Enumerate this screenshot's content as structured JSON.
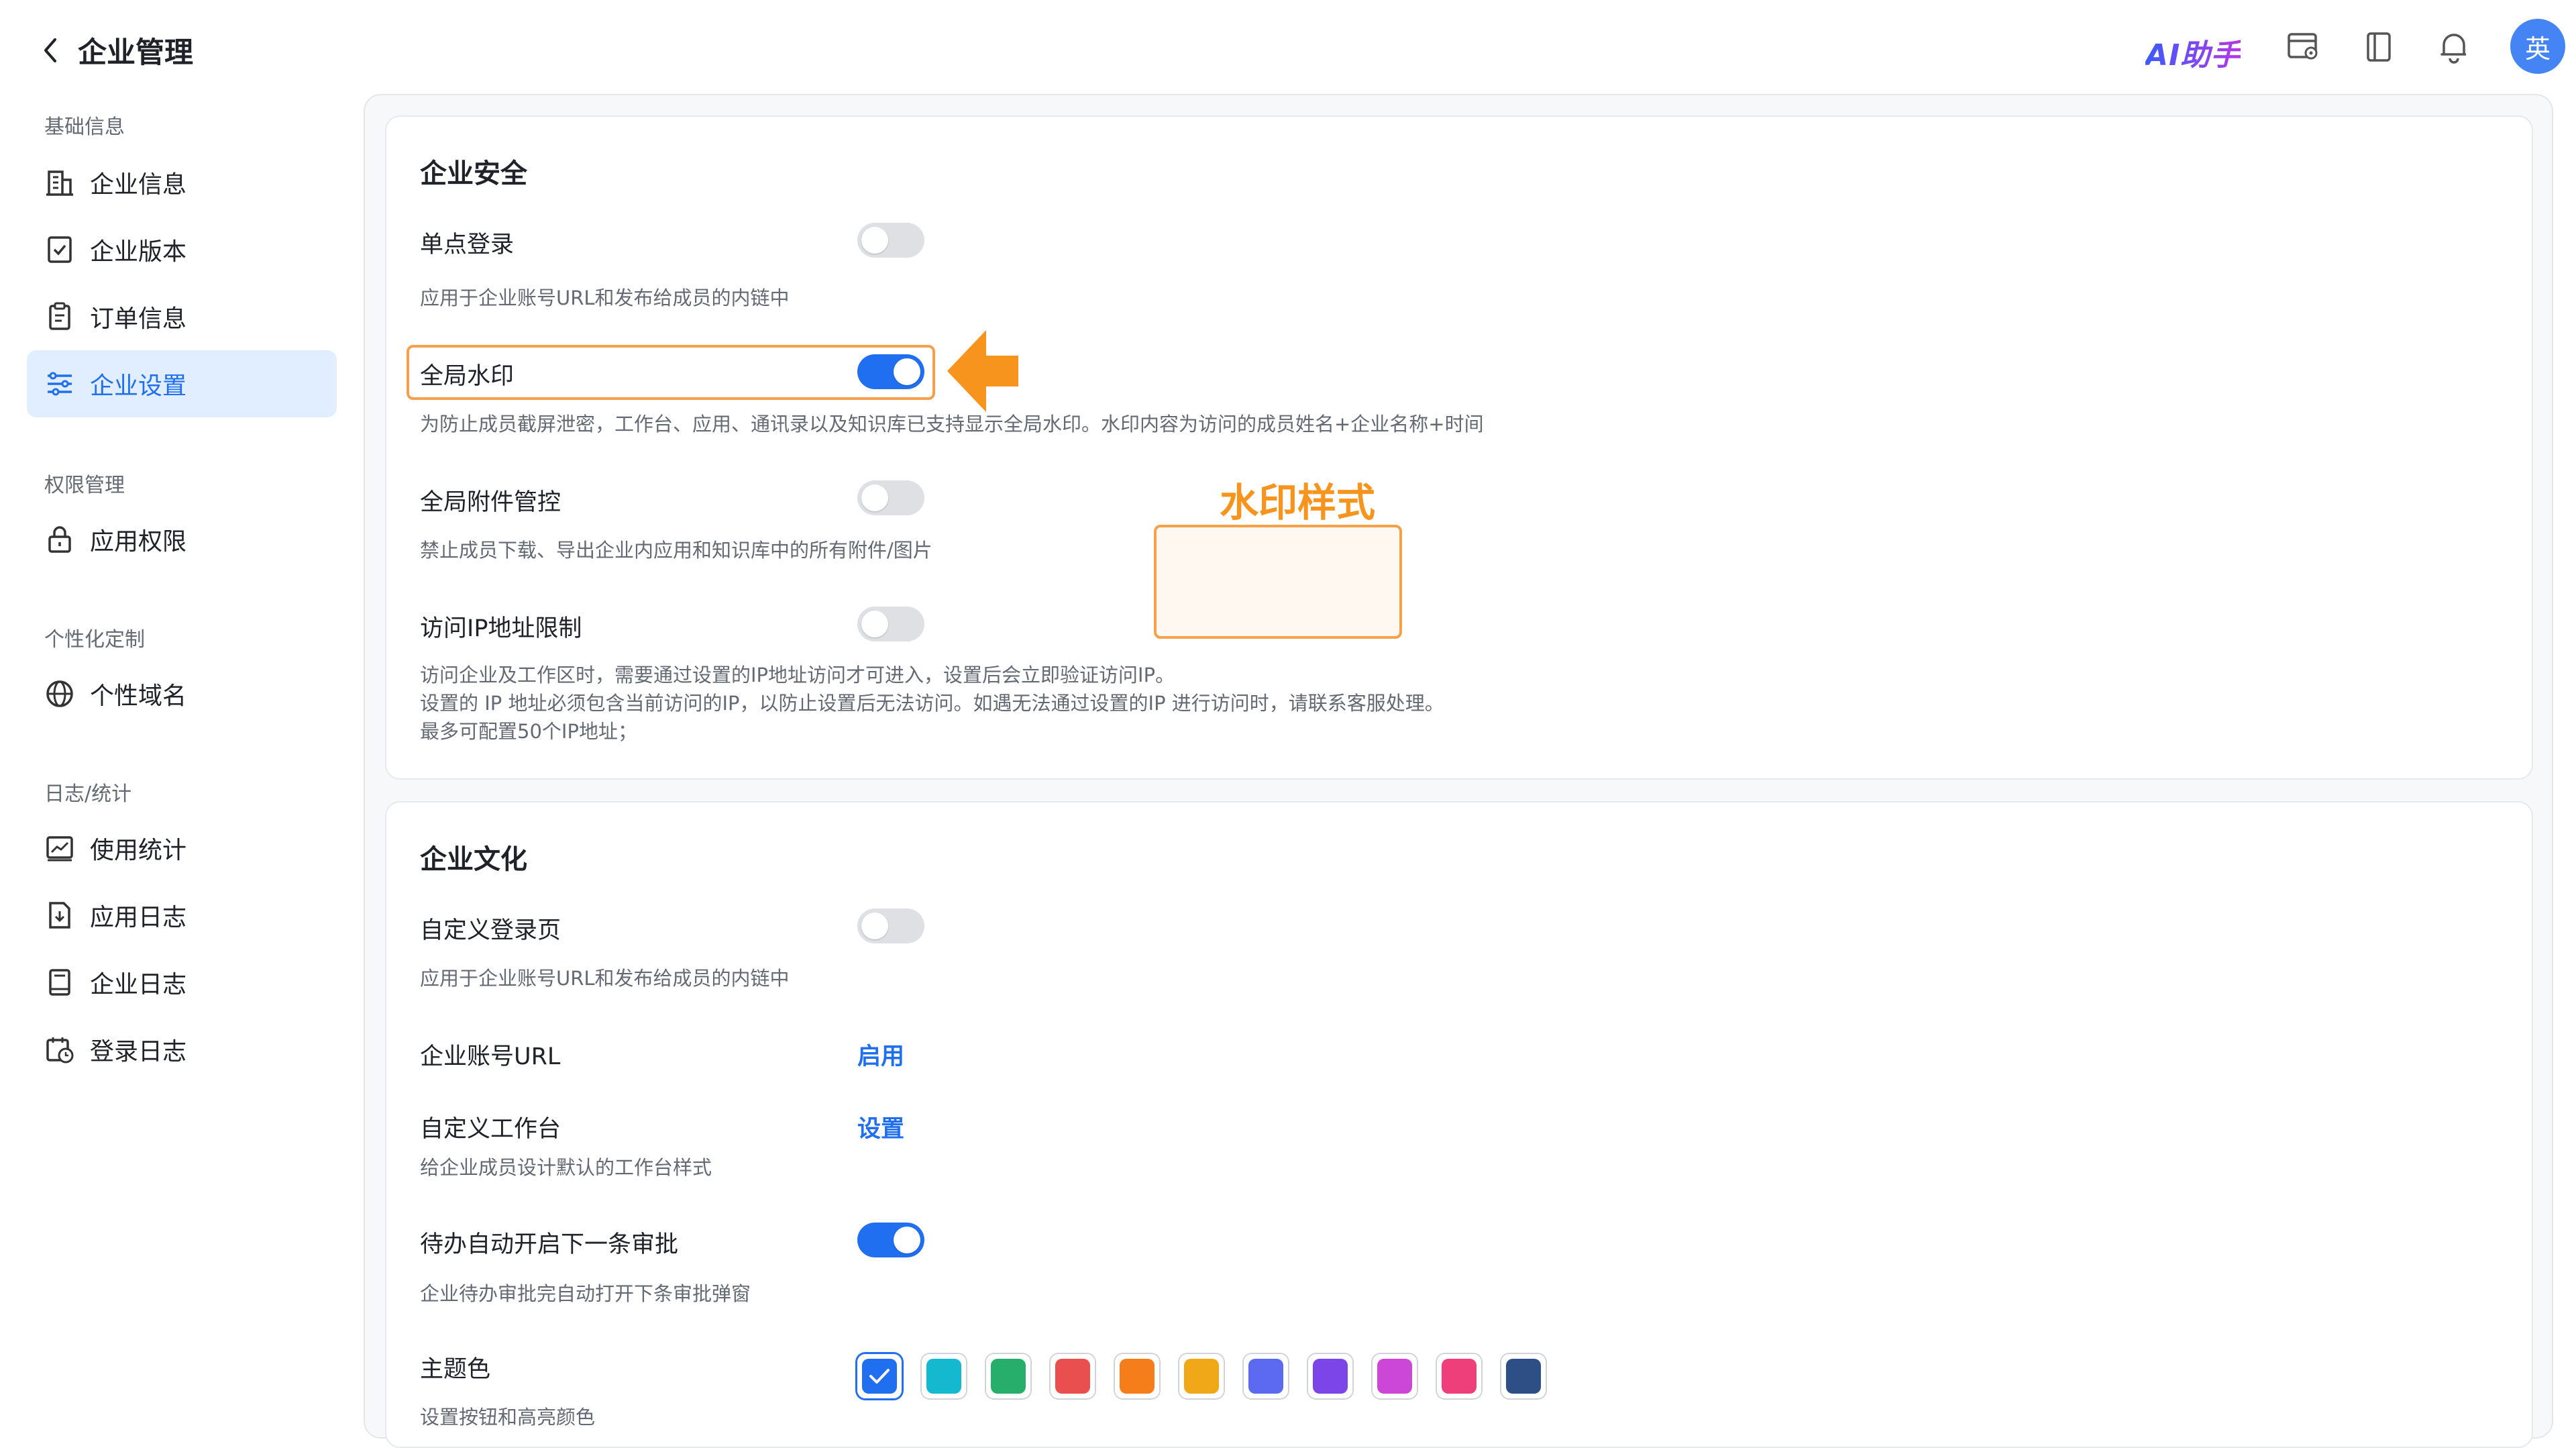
{
  "header": {
    "title": "企业管理",
    "ai_label": "AI助手",
    "avatar_text": "英"
  },
  "sidebar": {
    "sections": [
      {
        "title": "基础信息",
        "items": [
          {
            "label": "企业信息",
            "icon": "building-icon"
          },
          {
            "label": "企业版本",
            "icon": "version-icon"
          },
          {
            "label": "订单信息",
            "icon": "clipboard-icon"
          },
          {
            "label": "企业设置",
            "icon": "settings-sliders-icon",
            "active": true
          }
        ]
      },
      {
        "title": "权限管理",
        "items": [
          {
            "label": "应用权限",
            "icon": "lock-icon"
          }
        ]
      },
      {
        "title": "个性化定制",
        "items": [
          {
            "label": "个性域名",
            "icon": "globe-icon"
          }
        ]
      },
      {
        "title": "日志/统计",
        "items": [
          {
            "label": "使用统计",
            "icon": "chart-line-icon"
          },
          {
            "label": "应用日志",
            "icon": "download-doc-icon"
          },
          {
            "label": "企业日志",
            "icon": "book-icon"
          },
          {
            "label": "登录日志",
            "icon": "calendar-clock-icon"
          }
        ]
      }
    ]
  },
  "security": {
    "title": "企业安全",
    "sso": {
      "label": "单点登录",
      "desc": "应用于企业账号URL和发布给成员的内链中",
      "enabled": false
    },
    "watermark": {
      "label": "全局水印",
      "desc": "为防止成员截屏泄密，工作台、应用、通讯录以及知识库已支持显示全局水印。水印内容为访问的成员姓名+企业名称+时间",
      "enabled": true
    },
    "attachments": {
      "label": "全局附件管控",
      "desc": "禁止成员下载、导出企业内应用和知识库中的所有附件/图片",
      "enabled": false
    },
    "ip_limit": {
      "label": "访问IP地址限制",
      "desc1": "访问企业及工作区时，需要通过设置的IP地址访问才可进入，设置后会立即验证访问IP。",
      "desc2": "设置的 IP 地址必须包含当前访问的IP，以防止设置后无法访问。如遇无法通过设置的IP 进行访问时，请联系客服处理。",
      "desc3": "最多可配置50个IP地址；",
      "enabled": false
    },
    "annotation_title": "水印样式"
  },
  "culture": {
    "title": "企业文化",
    "login_page": {
      "label": "自定义登录页",
      "desc": "应用于企业账号URL和发布给成员的内链中",
      "enabled": false
    },
    "account_url": {
      "label": "企业账号URL",
      "action": "启用"
    },
    "workbench": {
      "label": "自定义工作台",
      "action": "设置",
      "desc": "给企业成员设计默认的工作台样式"
    },
    "auto_approval": {
      "label": "待办自动开启下一条审批",
      "desc": "企业待办审批完自动打开下条审批弹窗",
      "enabled": true
    },
    "theme": {
      "label": "主题色",
      "desc": "设置按钮和高亮颜色",
      "colors": [
        "#1f6ff0",
        "#14b8cf",
        "#27ae6b",
        "#e94f4f",
        "#f57d1a",
        "#f0a818",
        "#5b6af0",
        "#7c45e8",
        "#cc46d8",
        "#ee3f7b",
        "#2e4f85"
      ],
      "selected_index": 0
    }
  }
}
